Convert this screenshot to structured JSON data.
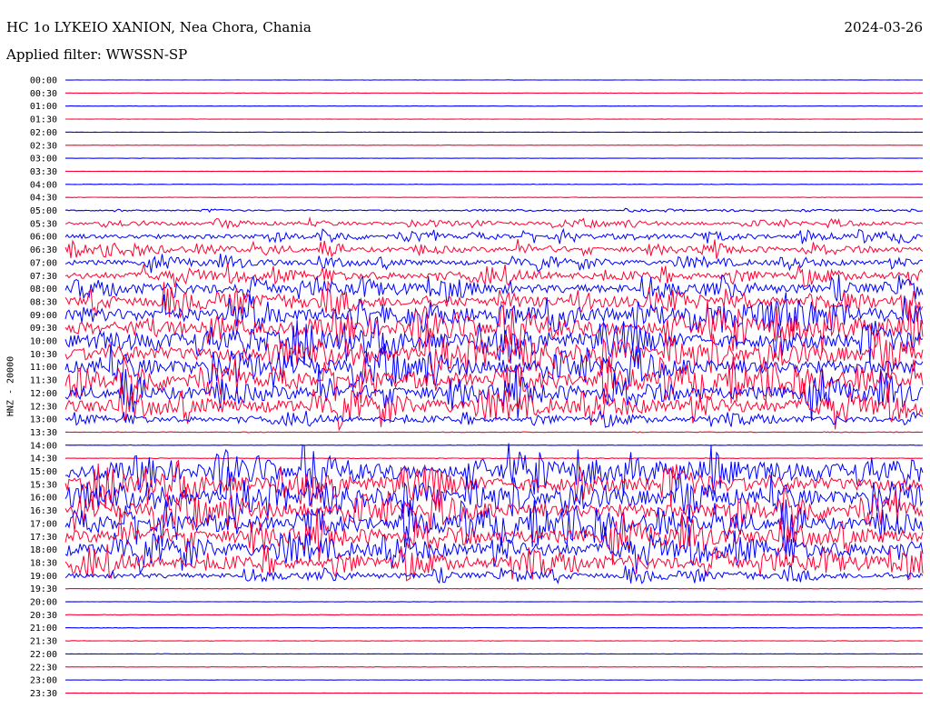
{
  "header": {
    "station": "HC 1o LYKEIO XANION, Nea Chora, Chania",
    "date": "2024-03-26",
    "filter_label": "Applied filter: WWSSN-SP"
  },
  "colors": {
    "blue": "#0000ff",
    "red": "#ff0033"
  },
  "chart_data": {
    "type": "line",
    "title": "",
    "ylabel": "HNZ - 20000",
    "xlabel": "",
    "row_labels": [
      "00:00",
      "00:30",
      "01:00",
      "01:30",
      "02:00",
      "02:30",
      "03:00",
      "03:30",
      "04:00",
      "04:30",
      "05:00",
      "05:30",
      "06:00",
      "06:30",
      "07:00",
      "07:30",
      "08:00",
      "08:30",
      "09:00",
      "09:30",
      "10:00",
      "10:30",
      "11:00",
      "11:30",
      "12:00",
      "12:30",
      "13:00",
      "13:30",
      "14:00",
      "14:30",
      "15:00",
      "15:30",
      "16:00",
      "16:30",
      "17:00",
      "17:30",
      "18:00",
      "18:30",
      "19:00",
      "19:30",
      "20:00",
      "20:30",
      "21:00",
      "21:30",
      "22:00",
      "22:30",
      "23:00",
      "23:30"
    ],
    "row_colors": [
      "blue",
      "red"
    ],
    "activity_level": [
      0.02,
      0.02,
      0.02,
      0.03,
      0.02,
      0.02,
      0.02,
      0.02,
      0.05,
      0.05,
      0.25,
      0.45,
      0.55,
      0.6,
      0.6,
      0.7,
      0.8,
      0.85,
      0.95,
      1.0,
      1.0,
      1.0,
      1.0,
      1.0,
      1.0,
      1.0,
      0.6,
      0.1,
      0.05,
      0.1,
      1.0,
      1.0,
      1.0,
      1.0,
      1.0,
      1.0,
      1.0,
      0.9,
      0.6,
      0.05,
      0.04,
      0.04,
      0.05,
      0.05,
      0.04,
      0.03,
      0.03,
      0.02
    ]
  }
}
